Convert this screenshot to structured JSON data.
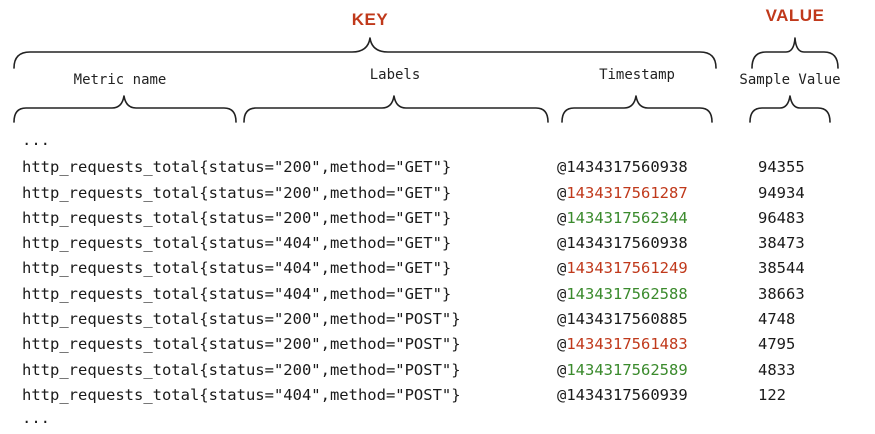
{
  "headers": {
    "key": "KEY",
    "value": "VALUE"
  },
  "labels": {
    "metric_name": "Metric name",
    "labels": "Labels",
    "timestamp": "Timestamp",
    "sample_value": "Sample Value"
  },
  "colors": {
    "header": "#c0391b",
    "red_timestamp": "#c0391b",
    "green_timestamp": "#3a8a2c",
    "text": "#1a1a1a"
  },
  "ellipsis_top": "...",
  "ellipsis_bottom": "...",
  "rows": [
    {
      "metric": "http_requests_total{status=\"200\",method=\"GET\"}",
      "at": "@",
      "ts": "1434317560938",
      "ts_color": "default",
      "value": "94355"
    },
    {
      "metric": "http_requests_total{status=\"200\",method=\"GET\"}",
      "at": "@",
      "ts": "1434317561287",
      "ts_color": "red",
      "value": "94934"
    },
    {
      "metric": "http_requests_total{status=\"200\",method=\"GET\"}",
      "at": "@",
      "ts": "1434317562344",
      "ts_color": "green",
      "value": "96483"
    },
    {
      "metric": "http_requests_total{status=\"404\",method=\"GET\"}",
      "at": "@",
      "ts": "1434317560938",
      "ts_color": "default",
      "value": "38473"
    },
    {
      "metric": "http_requests_total{status=\"404\",method=\"GET\"}",
      "at": "@",
      "ts": "1434317561249",
      "ts_color": "red",
      "value": "38544"
    },
    {
      "metric": "http_requests_total{status=\"404\",method=\"GET\"}",
      "at": "@",
      "ts": "1434317562588",
      "ts_color": "green",
      "value": "38663"
    },
    {
      "metric": "http_requests_total{status=\"200\",method=\"POST\"}",
      "at": "@",
      "ts": "1434317560885",
      "ts_color": "default",
      "value": "4748"
    },
    {
      "metric": "http_requests_total{status=\"200\",method=\"POST\"}",
      "at": "@",
      "ts": "1434317561483",
      "ts_color": "red",
      "value": "4795"
    },
    {
      "metric": "http_requests_total{status=\"200\",method=\"POST\"}",
      "at": "@",
      "ts": "1434317562589",
      "ts_color": "green",
      "value": "4833"
    },
    {
      "metric": "http_requests_total{status=\"404\",method=\"POST\"}",
      "at": "@",
      "ts": "1434317560939",
      "ts_color": "default",
      "value": "122"
    }
  ]
}
